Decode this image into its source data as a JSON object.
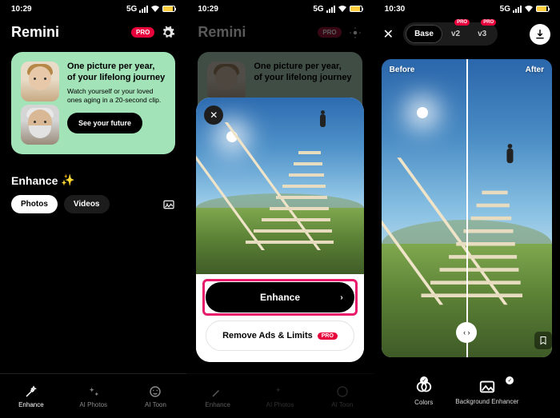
{
  "status": {
    "time1": "10:29",
    "time2": "10:29",
    "time3": "10:30",
    "net": "5G"
  },
  "app": {
    "brand": "Remini",
    "pro": "PRO"
  },
  "promo": {
    "title1": "One picture per year,",
    "title2": "of your lifelong journey",
    "sub": "Watch yourself or your loved ones aging in a 20-second clip.",
    "cta": "See your future"
  },
  "enhance_section": {
    "title": "Enhance",
    "spark": "✨"
  },
  "tabs": {
    "photos": "Photos",
    "videos": "Videos"
  },
  "nav": {
    "enhance": "Enhance",
    "ai_photos": "AI Photos",
    "ai_toon": "AI Toon"
  },
  "sheet": {
    "enhance": "Enhance",
    "remove": "Remove Ads & Limits",
    "pro": "PRO"
  },
  "s3": {
    "base": "Base",
    "v2": "v2",
    "v3": "v3",
    "pro": "PRO",
    "before": "Before",
    "after": "After",
    "colors": "Colors",
    "bg": "Background Enhancer"
  }
}
